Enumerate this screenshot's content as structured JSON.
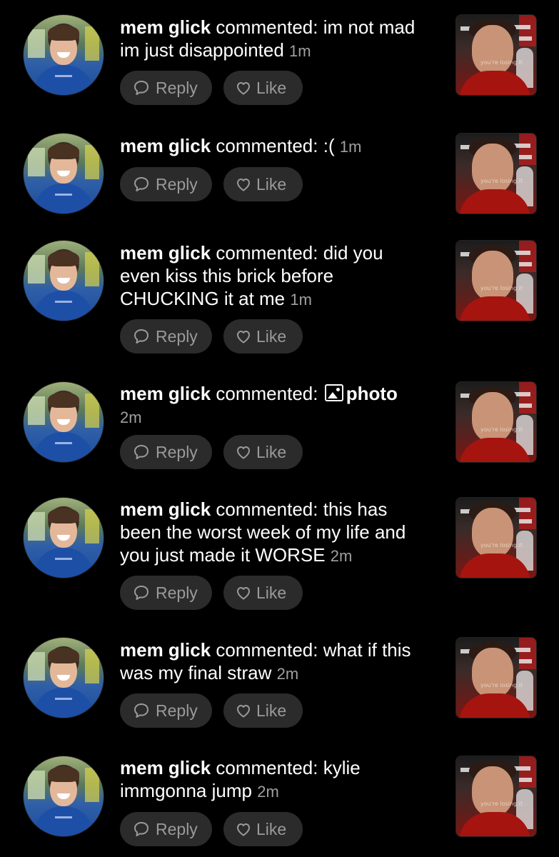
{
  "labels": {
    "reply": "Reply",
    "like": "Like"
  },
  "icons": {
    "reply": "speech-bubble-icon",
    "like": "heart-icon",
    "photo": "image-icon"
  },
  "thumbnail_caption": "you're losing it",
  "notifications": [
    {
      "user": "mem glick",
      "verb": "commented:",
      "comment": "im not mad im just disappointed",
      "time": "1m"
    },
    {
      "user": "mem glick",
      "verb": "commented:",
      "comment": ":(",
      "time": "1m"
    },
    {
      "user": "mem glick",
      "verb": "commented:",
      "comment": "did you even kiss this brick before CHUCKING it at me",
      "time": "1m"
    },
    {
      "user": "mem glick",
      "verb": "commented:",
      "comment": "photo",
      "time": "2m"
    },
    {
      "user": "mem glick",
      "verb": "commented:",
      "comment": "this has been the worst week of my life and you just made it WORSE",
      "time": "2m"
    },
    {
      "user": "mem glick",
      "verb": "commented:",
      "comment": "what if this was my final straw",
      "time": "2m"
    },
    {
      "user": "mem glick",
      "verb": "commented:",
      "comment": "kylie immgonna jump",
      "time": "2m"
    }
  ]
}
